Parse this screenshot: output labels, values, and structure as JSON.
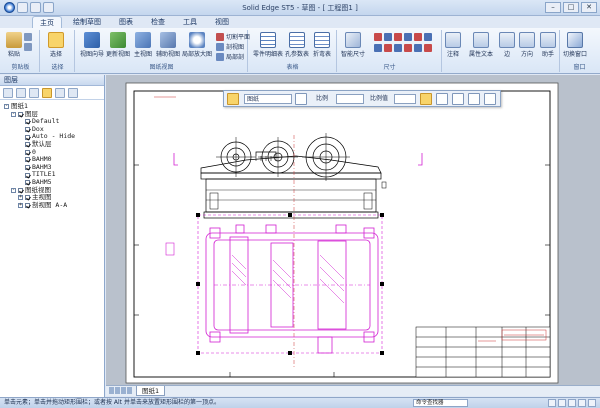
{
  "window": {
    "title": "Solid Edge ST5 - 草图 - [ 工程图1 ]",
    "controls": [
      "–",
      "□",
      "✕"
    ]
  },
  "tabs": [
    "主页",
    "绘制草图",
    "图表",
    "检查",
    "工具",
    "视图"
  ],
  "ribbon": {
    "groups": [
      {
        "label": "剪贴板",
        "buttons": [
          "粘贴"
        ]
      },
      {
        "label": "选择",
        "buttons": [
          "选择"
        ]
      },
      {
        "label": "图纸视图",
        "buttons": [
          "视图向导",
          "更新视图",
          "主视图",
          "辅助视图",
          "局部放大图"
        ],
        "small": [
          "切割平面",
          "剖视图",
          "局部剖"
        ]
      },
      {
        "label": "表格",
        "buttons": [
          "零件明细表",
          "孔参数表",
          "折弯表"
        ]
      },
      {
        "label": "尺寸",
        "buttons": [
          "智能尺寸"
        ]
      },
      {
        "label": "",
        "buttons": [
          "注释",
          "属性文本",
          "边",
          "方向",
          "助手"
        ]
      },
      {
        "label": "窗口",
        "buttons": [
          "切换窗口"
        ]
      }
    ]
  },
  "panel": {
    "title": "图层",
    "tree": [
      {
        "level": 0,
        "expander": "-",
        "check": false,
        "label": "图纸1"
      },
      {
        "level": 1,
        "expander": "-",
        "check": true,
        "label": "图层"
      },
      {
        "level": 2,
        "expander": "",
        "check": true,
        "label": "Default"
      },
      {
        "level": 2,
        "expander": "",
        "check": true,
        "label": "Dox"
      },
      {
        "level": 2,
        "expander": "",
        "check": true,
        "label": "Auto - Hide"
      },
      {
        "level": 2,
        "expander": "",
        "check": true,
        "label": "默认层"
      },
      {
        "level": 2,
        "expander": "",
        "check": true,
        "label": "0"
      },
      {
        "level": 2,
        "expander": "",
        "check": true,
        "label": "BAHM0"
      },
      {
        "level": 2,
        "expander": "",
        "check": true,
        "label": "BAHM3"
      },
      {
        "level": 2,
        "expander": "",
        "check": true,
        "label": "TITLE1"
      },
      {
        "level": 2,
        "expander": "",
        "check": true,
        "label": "BAHM5"
      },
      {
        "level": 1,
        "expander": "-",
        "check": true,
        "label": "图纸视图"
      },
      {
        "level": 2,
        "expander": "+",
        "check": true,
        "label": "主视图"
      },
      {
        "level": 2,
        "expander": "+",
        "check": true,
        "label": "剖视图 A-A"
      }
    ]
  },
  "floating_toolbar": {
    "layer_value": "图纸",
    "scale_label": "比例",
    "scale_value_label": "比例值"
  },
  "sheet_tab": "图纸1",
  "status": {
    "text": "单击元素；单击并拖动矩形围栏；或者按 Alt 并单击来放置矩形围栏的第一顶点。",
    "command_finder": "命令查找器"
  },
  "colors": {
    "ribbon_bg": "#dbe7f6",
    "drawing_line": "#000000",
    "selection": "#d21fd2",
    "highlight": "#f8d46a"
  }
}
